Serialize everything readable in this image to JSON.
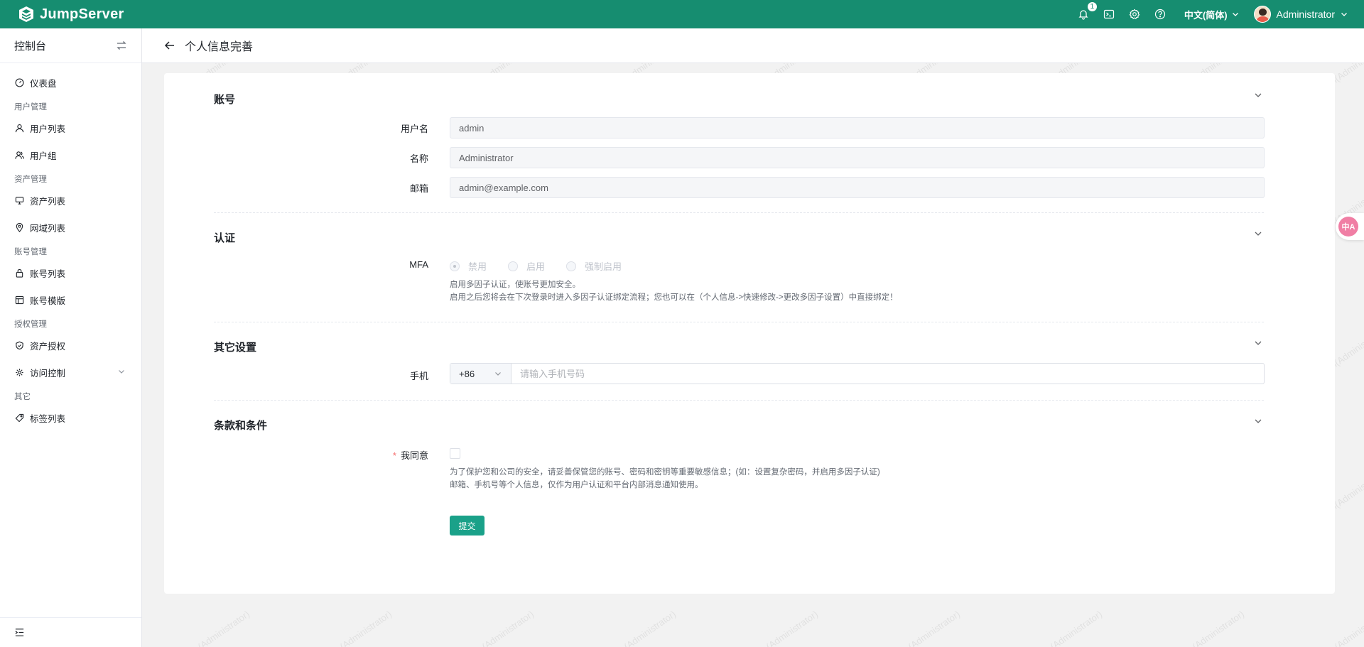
{
  "app": {
    "name": "JumpServer"
  },
  "topbar": {
    "notification_count": "1",
    "language": "中文(简体)",
    "user_name": "Administrator"
  },
  "sidebar": {
    "title": "控制台",
    "dashboard": "仪表盘",
    "groups": {
      "user_mgmt": "用户管理",
      "asset_mgmt": "资产管理",
      "account_mgmt": "账号管理",
      "perm_mgmt": "授权管理",
      "other": "其它"
    },
    "items": {
      "user_list": "用户列表",
      "user_group": "用户组",
      "asset_list": "资产列表",
      "domain_list": "网域列表",
      "account_list": "账号列表",
      "account_template": "账号模版",
      "asset_perm": "资产授权",
      "access_control": "访问控制",
      "label_list": "标签列表"
    }
  },
  "page": {
    "title": "个人信息完善"
  },
  "form": {
    "account_section": "账号",
    "username_label": "用户名",
    "username": "admin",
    "name_label": "名称",
    "name": "Administrator",
    "email_label": "邮箱",
    "email": "admin@example.com",
    "auth_section": "认证",
    "mfa_label": "MFA",
    "mfa_options": [
      "禁用",
      "启用",
      "强制启用"
    ],
    "mfa_help_1": "启用多因子认证，使账号更加安全。",
    "mfa_help_2": "启用之后您将会在下次登录时进入多因子认证绑定流程；您也可以在（个人信息->快速修改->更改多因子设置）中直接绑定！",
    "other_section": "其它设置",
    "phone_label": "手机",
    "phone_code": "+86",
    "phone_placeholder": "请输入手机号码",
    "terms_section": "条款和条件",
    "agree_label": "我同意",
    "terms_help_1": "为了保护您和公司的安全，请妥善保管您的账号、密码和密钥等重要敏感信息；(如：设置复杂密码，并启用多因子认证)",
    "terms_help_2": "邮箱、手机号等个人信息，仅作为用户认证和平台内部消息通知使用。",
    "submit": "提交"
  },
  "translate_widget": "中A",
  "watermark": "admin(Administrator)",
  "colors": {
    "brand": "#168d70",
    "button": "#1aa189"
  }
}
